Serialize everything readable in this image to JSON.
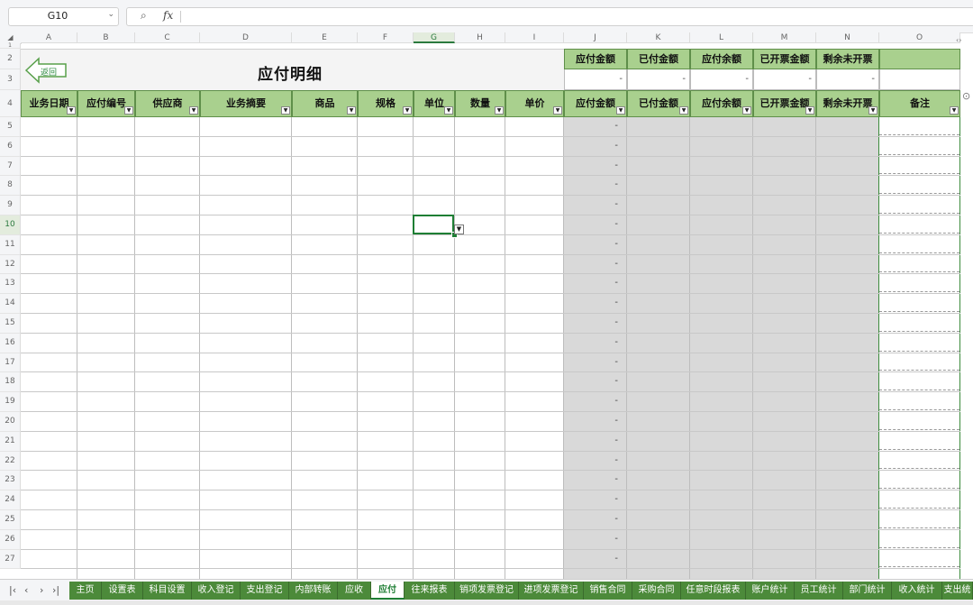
{
  "formula_bar": {
    "cell_ref": "G10",
    "formula": ""
  },
  "column_letters": [
    "A",
    "B",
    "C",
    "D",
    "E",
    "F",
    "G",
    "H",
    "I",
    "J",
    "K",
    "L",
    "M",
    "N",
    "O"
  ],
  "row_numbers_top": [
    "1",
    "2",
    "3",
    "4"
  ],
  "row_numbers": [
    "5",
    "6",
    "7",
    "8",
    "9",
    "10",
    "11",
    "12",
    "13",
    "14",
    "15",
    "16",
    "17",
    "18",
    "19",
    "20",
    "21",
    "22",
    "23",
    "24",
    "25",
    "26",
    "27"
  ],
  "title": "应付明细",
  "back_label": "返回",
  "summary": {
    "headers": [
      "应付金额",
      "已付金额",
      "应付余额",
      "已开票金额",
      "剩余未开票"
    ],
    "values": [
      "-",
      "-",
      "-",
      "-",
      "-"
    ]
  },
  "table_headers": [
    "业务日期",
    "应付编号",
    "供应商",
    "业务摘要",
    "商品",
    "规格",
    "单位",
    "数量",
    "单价",
    "应付金额",
    "已付金额",
    "应付余额",
    "已开票金额",
    "剩余未开票",
    "备注"
  ],
  "empty_value": "-",
  "sheet_tabs": [
    "主页",
    "设置表",
    "科目设置",
    "收入登记",
    "支出登记",
    "内部转账",
    "应收",
    "应付",
    "往来报表",
    "销项发票登记",
    "进项发票登记",
    "销售合同",
    "采购合同",
    "任意时段报表",
    "账户统计",
    "员工统计",
    "部门统计",
    "收入统计",
    "支出统"
  ],
  "active_tab": "应付",
  "colors": {
    "header_green": "#a9d08e",
    "tab_green": "#4c8a3a",
    "select_green": "#1e7e34",
    "calc_gray": "#d9d9d9"
  }
}
